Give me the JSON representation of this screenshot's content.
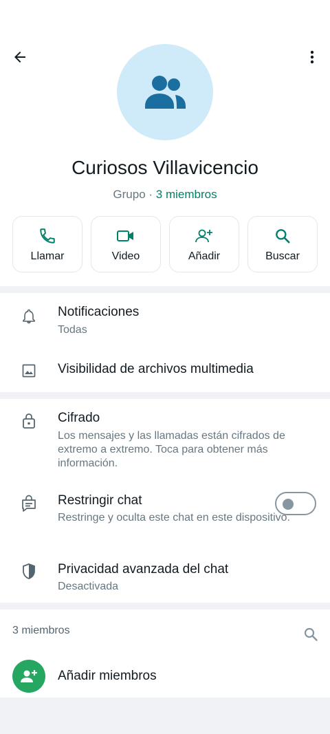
{
  "header": {
    "back_icon": "arrow-left-icon",
    "more_icon": "more-vertical-icon",
    "avatar_icon": "group-icon",
    "group_name": "Curiosos Villavicencio",
    "type_label": "Grupo",
    "separator": " · ",
    "members_label": "3 miembros"
  },
  "actions": [
    {
      "label": "Llamar",
      "icon": "phone-icon"
    },
    {
      "label": "Video",
      "icon": "video-icon"
    },
    {
      "label": "Añadir",
      "icon": "add-person-icon"
    },
    {
      "label": "Buscar",
      "icon": "search-icon"
    }
  ],
  "settings": {
    "notifications": {
      "title": "Notificaciones",
      "subtitle": "Todas"
    },
    "media_visibility": {
      "title": "Visibilidad de archivos multimedia"
    },
    "encryption": {
      "title": "Cifrado",
      "subtitle": "Los mensajes y las llamadas están cifrados de extremo a extremo. Toca para obtener más información."
    },
    "restrict_chat": {
      "title": "Restringir chat",
      "subtitle": "Restringe y oculta este chat en este dispositivo.",
      "enabled": false
    },
    "advanced_privacy": {
      "title": "Privacidad avanzada del chat",
      "subtitle": "Desactivada"
    }
  },
  "members": {
    "count_label": "3 miembros",
    "add_label": "Añadir miembros"
  },
  "colors": {
    "accent": "#008069",
    "add_button": "#25a661",
    "avatar_bg": "#cfeaf8",
    "avatar_icon": "#1b6fa0"
  }
}
